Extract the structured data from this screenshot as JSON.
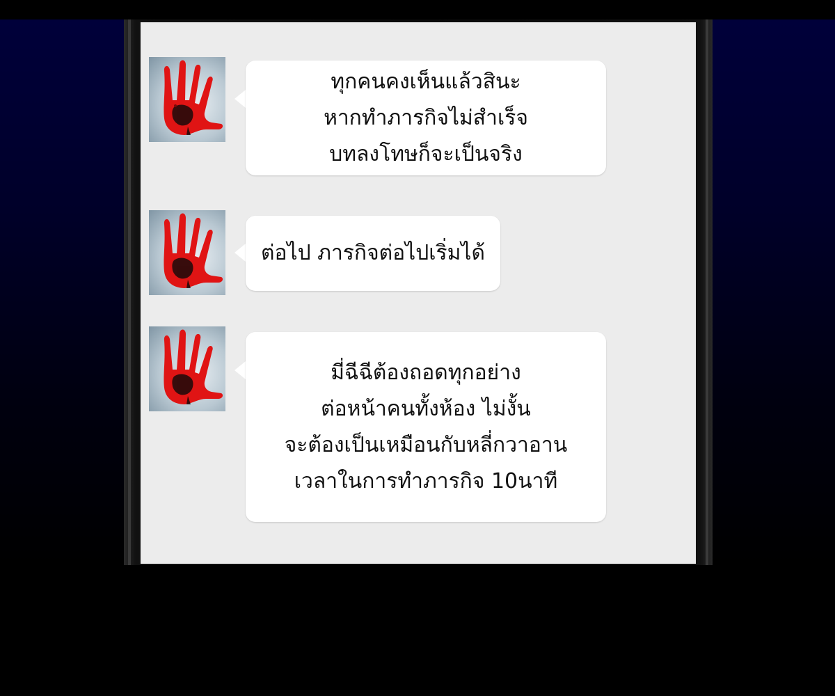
{
  "chat": {
    "messages": [
      {
        "avatar_icon": "bloody-hand-icon",
        "lines": [
          "ทุกคนคงเห็นแล้วสินะ",
          "หากทำภารกิจไม่สำเร็จ",
          "บทลงโทษก็จะเป็นจริง"
        ]
      },
      {
        "avatar_icon": "bloody-hand-icon",
        "lines": [
          "ต่อไป ภารกิจต่อไปเริ่มได้"
        ]
      },
      {
        "avatar_icon": "bloody-hand-icon",
        "lines": [
          "มี่ฉีฉีต้องถอดทุกอย่าง",
          "ต่อหน้าคนทั้งห้อง ไม่งั้น",
          "จะต้องเป็นเหมือนกับหลี่กวาอาน",
          "เวลาในการทำภารกิจ 10นาที"
        ]
      }
    ]
  },
  "colors": {
    "screen_bg": "#ececec",
    "bubble_bg": "#ffffff",
    "hand_red": "#e01414",
    "backdrop_navy": "#00003a"
  }
}
